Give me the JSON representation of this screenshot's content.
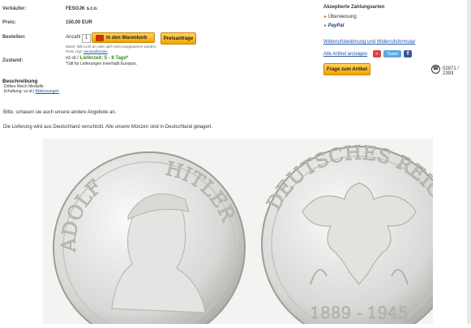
{
  "seller": {
    "label": "Verkäufer:",
    "value": "FESOJK s.r.o."
  },
  "price": {
    "label": "Preis:",
    "value": "150,00 EUR"
  },
  "order": {
    "label": "Bestellen:",
    "qty_label": "Anzahl",
    "qty_value": "1",
    "cart_button": "In den Warenkorb",
    "offer_button": "Preisanfrage",
    "note1": "MwSt. fällt nicht an oder darf nicht ausgewiesen werden.",
    "note2_prefix": "Preis zzgl. ",
    "note2_link": "Versandkosten"
  },
  "state": {
    "label": "Zustand:",
    "prefix": "vz-st / ",
    "delivery": "Lieferzeit: 5 - 8 Tage*",
    "note": "*Gilt für Lieferungen innerhalb Europas."
  },
  "payment": {
    "title": "Akzeptierte Zahlungsarten",
    "bank": "Überweisung",
    "paypal": "PayPal"
  },
  "legal": {
    "links": "Widerrufsbelehrung und Widerrufsformular"
  },
  "actions": {
    "all_items": "Alle Artikel anzeigen",
    "tweet": "Tweet",
    "ask_button": "Frage zum Artikel",
    "phone": "02871 / 2393"
  },
  "description": {
    "title": "Beschreibung",
    "line1": "Drittes Reich Medaille",
    "line2_prefix": "Erhaltung: vz-st | ",
    "line2_link": "Abkürzungen"
  },
  "text": {
    "offer": "Bitte, schauen sie auch unsere andere Angebote an.",
    "shipping": "Die Lieferung wird aus Deutschland verschickt. Alle unsere Münzen sind in Deutschland gelagert."
  },
  "coin": {
    "obverse_left": "ADOLF",
    "obverse_right": "HITLER",
    "reverse_top": "DEUTSCHES REICH",
    "reverse_years": "1889 - 1945"
  },
  "colors": {
    "accent_button": "#f4a400",
    "link": "#2255aa",
    "delivery": "#3a8a1a"
  }
}
